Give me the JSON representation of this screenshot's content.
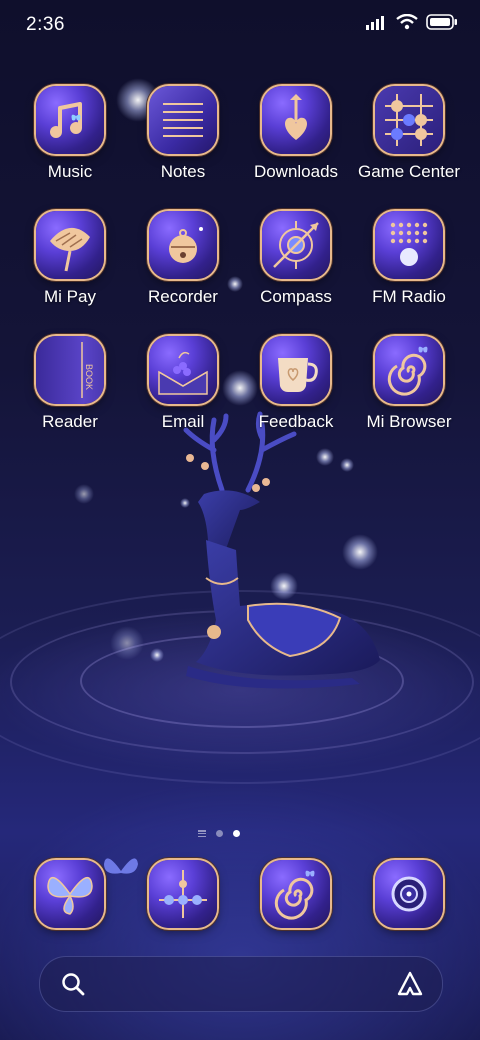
{
  "status_bar": {
    "time": "2:36"
  },
  "apps": [
    {
      "label": "Music",
      "icon": "music-icon"
    },
    {
      "label": "Notes",
      "icon": "notes-icon"
    },
    {
      "label": "Downloads",
      "icon": "downloads-icon"
    },
    {
      "label": "Game Center",
      "icon": "game-center-icon"
    },
    {
      "label": "Mi Pay",
      "icon": "mi-pay-icon"
    },
    {
      "label": "Recorder",
      "icon": "recorder-icon"
    },
    {
      "label": "Compass",
      "icon": "compass-icon"
    },
    {
      "label": "FM Radio",
      "icon": "fm-radio-icon"
    },
    {
      "label": "Reader",
      "icon": "reader-icon",
      "text": "BOOK"
    },
    {
      "label": "Email",
      "icon": "email-icon"
    },
    {
      "label": "Feedback",
      "icon": "feedback-icon"
    },
    {
      "label": "Mi Browser",
      "icon": "mi-browser-icon"
    }
  ],
  "dock": [
    {
      "icon": "butterfly-icon"
    },
    {
      "icon": "connect-icon"
    },
    {
      "icon": "spiral-icon"
    },
    {
      "icon": "camera-icon"
    }
  ],
  "page_indicator": {
    "pages": 2,
    "active": 2
  },
  "search_bar": {
    "search_icon": "search-icon",
    "assistant_icon": "assistant-icon"
  }
}
